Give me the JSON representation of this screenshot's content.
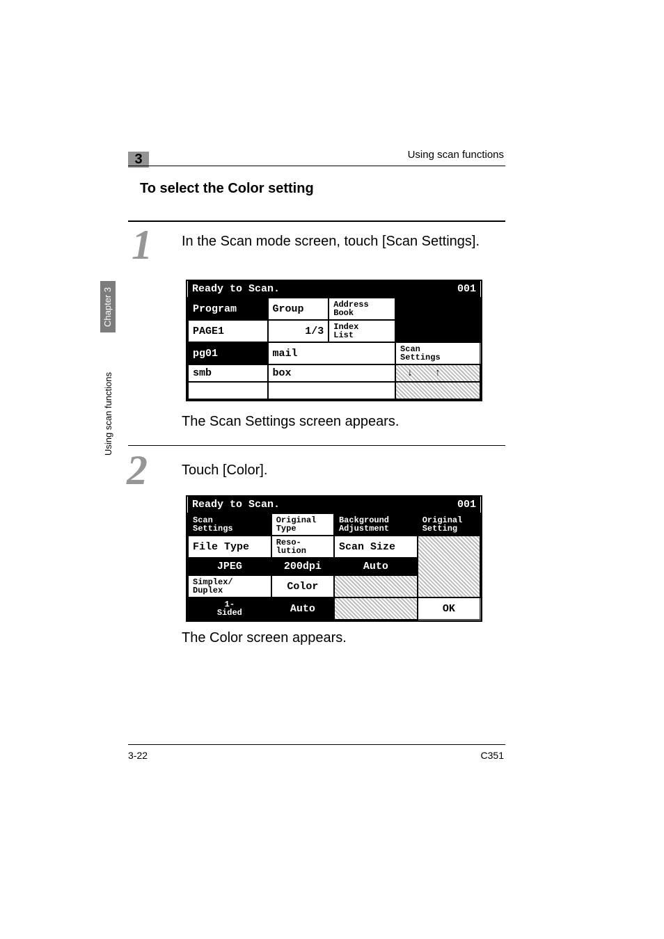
{
  "header": {
    "right": "Using scan functions",
    "chapter_num": "3"
  },
  "heading": "To select the Color setting",
  "steps": {
    "s1": "In the Scan mode screen, touch [Scan Settings].",
    "s1_after": "The Scan Settings screen appears.",
    "s2": "Touch [Color].",
    "s2_after": "The Color screen appears."
  },
  "sidebar": {
    "chapter": "Chapter 3",
    "functions": "Using scan functions"
  },
  "footer": {
    "left": "3-22",
    "right": "C351"
  },
  "lcd1": {
    "title": "Ready to Scan.",
    "counter": "001",
    "tabs": {
      "program": "Program",
      "group": "Group",
      "address": "Address\nBook"
    },
    "page_label": "PAGE1",
    "page_num": "1/3",
    "index": "Index\nList",
    "rows": [
      {
        "c1": "pg01",
        "c2": "mail"
      },
      {
        "c1": "smb",
        "c2": "box"
      },
      {
        "c1": "",
        "c2": ""
      }
    ],
    "scan_settings": "Scan\nSettings",
    "arrow_down": "↓",
    "arrow_up": "↑"
  },
  "lcd2": {
    "title": "Ready to Scan.",
    "counter": "001",
    "tabs": {
      "scan_settings": "Scan\nSettings",
      "original_type": "Original\nType",
      "background": "Background\nAdjustment",
      "original_setting": "Original\nSetting"
    },
    "row1": {
      "file_type_label": "File Type",
      "file_type_value": "JPEG",
      "reso_label": "Reso-\nlution",
      "reso_value": "200dpi",
      "size_label": "Scan Size",
      "size_value": "Auto"
    },
    "row2": {
      "duplex_label": "Simplex/\nDuplex",
      "duplex_value": "1-\nSided",
      "color_label": "Color",
      "color_value": "Auto"
    },
    "ok": "OK"
  },
  "chart_data": null
}
